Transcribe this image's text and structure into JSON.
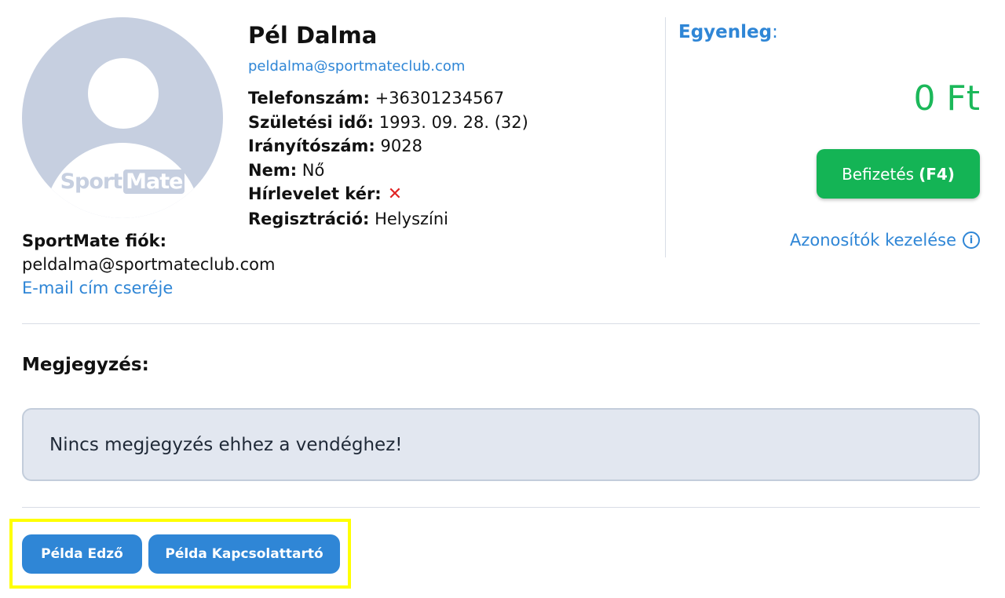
{
  "profile": {
    "name": "Pél Dalma",
    "email": "peldalma@sportmateclub.com",
    "avatar_logo_left": "Sport",
    "avatar_logo_right": "Mate",
    "fields": {
      "phone_label": "Telefonszám:",
      "phone_value": "+36301234567",
      "birth_label": "Születési idő:",
      "birth_value": "1993. 09. 28. (32)",
      "zip_label": "Irányítószám:",
      "zip_value": "9028",
      "gender_label": "Nem:",
      "gender_value": "Nő",
      "newsletter_label": "Hírlevelet kér:",
      "newsletter_value": "✕",
      "registration_label": "Regisztráció:",
      "registration_value": "Helyszíni"
    }
  },
  "account": {
    "label": "SportMate fiók:",
    "email": "peldalma@sportmateclub.com",
    "change_email_link": "E-mail cím cseréje"
  },
  "balance": {
    "label": "Egyenleg",
    "colon": ":",
    "value": "0 Ft",
    "pay_button": "Befizetés",
    "pay_shortcut": "(F4)",
    "ids_link": "Azonosítók kezelése",
    "info_icon_glyph": "i"
  },
  "notes": {
    "title": "Megjegyzés:",
    "text": "Nincs megjegyzés ehhez a vendéghez!"
  },
  "contacts": [
    {
      "label": "Példa Edző"
    },
    {
      "label": "Példa Kapcsolattartó"
    }
  ],
  "colors": {
    "accent_blue": "#2f86d6",
    "pay_green": "#14b455",
    "balance_green": "#1cb85a",
    "error_red": "#e02424",
    "highlight_yellow": "#ffff00"
  }
}
